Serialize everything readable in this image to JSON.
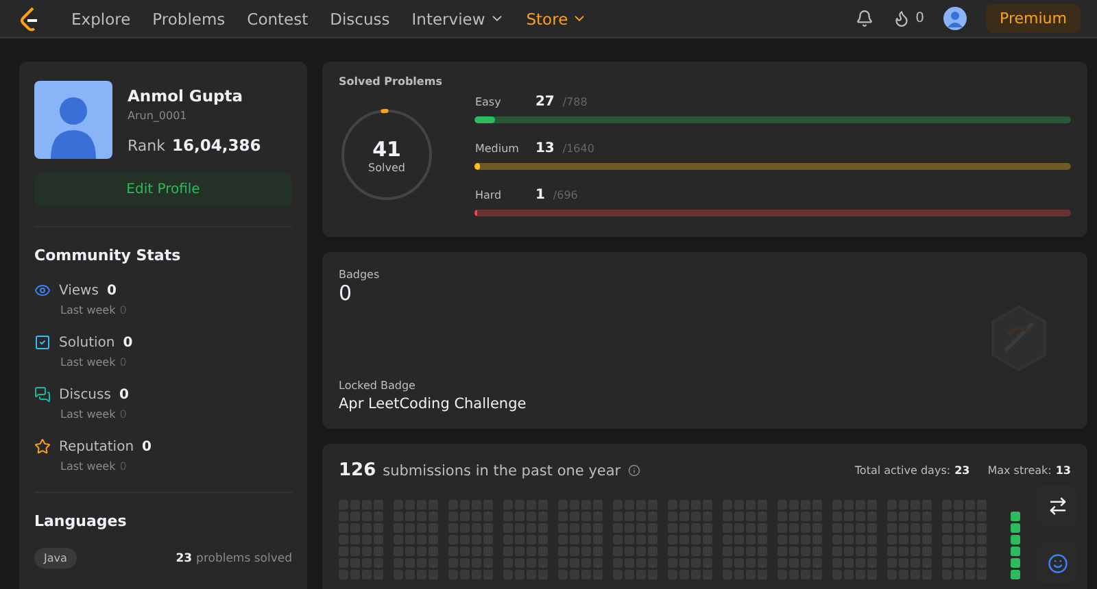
{
  "nav": {
    "items": [
      {
        "label": "Explore",
        "dropdown": false,
        "highlighted": false
      },
      {
        "label": "Problems",
        "dropdown": false,
        "highlighted": false
      },
      {
        "label": "Contest",
        "dropdown": false,
        "highlighted": false
      },
      {
        "label": "Discuss",
        "dropdown": false,
        "highlighted": false
      },
      {
        "label": "Interview",
        "dropdown": true,
        "highlighted": false
      },
      {
        "label": "Store",
        "dropdown": true,
        "highlighted": true
      }
    ],
    "streak": "0",
    "premium": "Premium"
  },
  "profile": {
    "name": "Anmol Gupta",
    "username": "Arun_0001",
    "rank_label": "Rank",
    "rank": "16,04,386",
    "edit": "Edit Profile"
  },
  "community": {
    "title": "Community Stats",
    "stats": [
      {
        "kind": "views",
        "label": "Views",
        "value": "0",
        "sub_label": "Last week",
        "sub_value": "0"
      },
      {
        "kind": "solution",
        "label": "Solution",
        "value": "0",
        "sub_label": "Last week",
        "sub_value": "0"
      },
      {
        "kind": "discuss",
        "label": "Discuss",
        "value": "0",
        "sub_label": "Last week",
        "sub_value": "0"
      },
      {
        "kind": "reputation",
        "label": "Reputation",
        "value": "0",
        "sub_label": "Last week",
        "sub_value": "0"
      }
    ]
  },
  "languages": {
    "title": "Languages",
    "items": [
      {
        "name": "Java",
        "count": "23",
        "suffix": "problems solved"
      }
    ]
  },
  "solved": {
    "title": "Solved Problems",
    "total": "41",
    "total_label": "Solved",
    "level": 0.013,
    "levels": [
      {
        "name": "Easy",
        "count": "27",
        "of": "/788",
        "level": 0.034,
        "color": "#2cbb5d"
      },
      {
        "name": "Medium",
        "count": "13",
        "of": "/1640",
        "level": 0.008,
        "color": "#ffc01e"
      },
      {
        "name": "Hard",
        "count": "1",
        "of": "/696",
        "level": 0.0014,
        "color": "#ef4743"
      }
    ]
  },
  "badges": {
    "title": "Badges",
    "count": "0",
    "locked_label": "Locked Badge",
    "locked_name": "Apr LeetCoding Challenge"
  },
  "submissions": {
    "count": "126",
    "text": "submissions in the past one year",
    "active_label": "Total active days:",
    "active": "23",
    "streak_label": "Max streak:",
    "streak": "13"
  }
}
